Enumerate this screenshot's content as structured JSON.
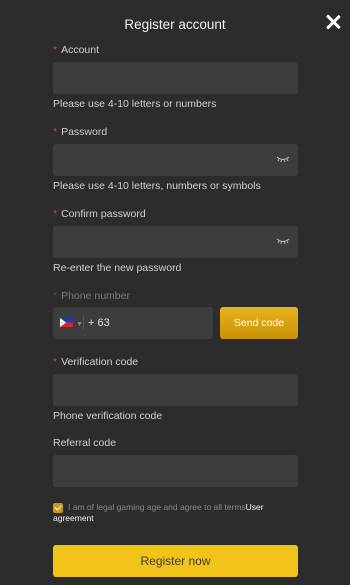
{
  "header": {
    "title": "Register account"
  },
  "account": {
    "label": "Account",
    "value": "",
    "hint": "Please use 4-10 letters or numbers"
  },
  "password": {
    "label": "Password",
    "value": "",
    "hint": "Please use 4-10 letters, numbers or symbols"
  },
  "confirm_password": {
    "label": "Confirm password",
    "value": "",
    "hint": "Re-enter the new password"
  },
  "phone": {
    "label": "Phone number",
    "dial_code": "+ 63",
    "country_flag": "philippines-flag-icon",
    "send_code_label": "Send code"
  },
  "verification": {
    "label": "Verification code",
    "value": "",
    "hint": "Phone verification code"
  },
  "referral": {
    "label": "Referral code",
    "value": ""
  },
  "agreement": {
    "checked": true,
    "text": "I am of legal gaming age and agree to all terms",
    "link": "User agreement"
  },
  "submit_label": "Register now",
  "colors": {
    "accent": "#f2c318",
    "background": "#2c2c2c",
    "field": "#3d3d3d",
    "required": "#d84a3a"
  }
}
